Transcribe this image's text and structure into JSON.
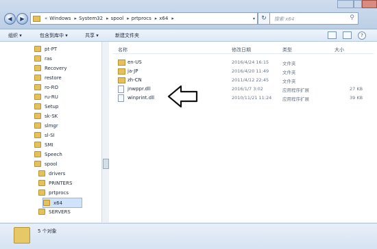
{
  "window": {
    "title_fragment": "Windows ... "
  },
  "address": {
    "history": "«",
    "crumbs": [
      "Windows",
      "System32",
      "spool",
      "prtprocs",
      "x64"
    ],
    "dropdown": "▾"
  },
  "search": {
    "placeholder": "搜索 x64"
  },
  "toolbar": {
    "organize": "组织 ▾",
    "include": "包含到库中 ▾",
    "share": "共享 ▾",
    "new_folder": "新建文件夹"
  },
  "nav": {
    "items": [
      {
        "label": "pt-PT"
      },
      {
        "label": "ras"
      },
      {
        "label": "Recovery"
      },
      {
        "label": "restore"
      },
      {
        "label": "ro-RO"
      },
      {
        "label": "ru-RU"
      },
      {
        "label": "Setup"
      },
      {
        "label": "sk-SK"
      },
      {
        "label": "slmgr"
      },
      {
        "label": "sl-SI"
      },
      {
        "label": "SMI"
      },
      {
        "label": "Speech"
      },
      {
        "label": "spool"
      },
      {
        "label": "drivers"
      },
      {
        "label": "PRINTERS"
      },
      {
        "label": "prtprocs"
      },
      {
        "label": "x64"
      },
      {
        "label": "SERVERS"
      }
    ]
  },
  "columns": {
    "name": "名称",
    "modified": "修改日期",
    "type": "类型",
    "size": "大小"
  },
  "files": [
    {
      "name": "en-US",
      "modified": "2016/4/24 16:15",
      "type": "文件夹",
      "size": "",
      "kind": "folder"
    },
    {
      "name": "ja-JP",
      "modified": "2016/4/20 11:49",
      "type": "文件夹",
      "size": "",
      "kind": "folder"
    },
    {
      "name": "zh-CN",
      "modified": "2011/4/12 22:45",
      "type": "文件夹",
      "size": "",
      "kind": "folder"
    },
    {
      "name": "jnwppr.dll",
      "modified": "2016/1/7 3:02",
      "type": "应用程序扩展",
      "size": "27 KB",
      "kind": "dll"
    },
    {
      "name": "winprint.dll",
      "modified": "2010/11/21 11:24",
      "type": "应用程序扩展",
      "size": "39 KB",
      "kind": "dll"
    }
  ],
  "status": {
    "count": "5 个对象"
  }
}
